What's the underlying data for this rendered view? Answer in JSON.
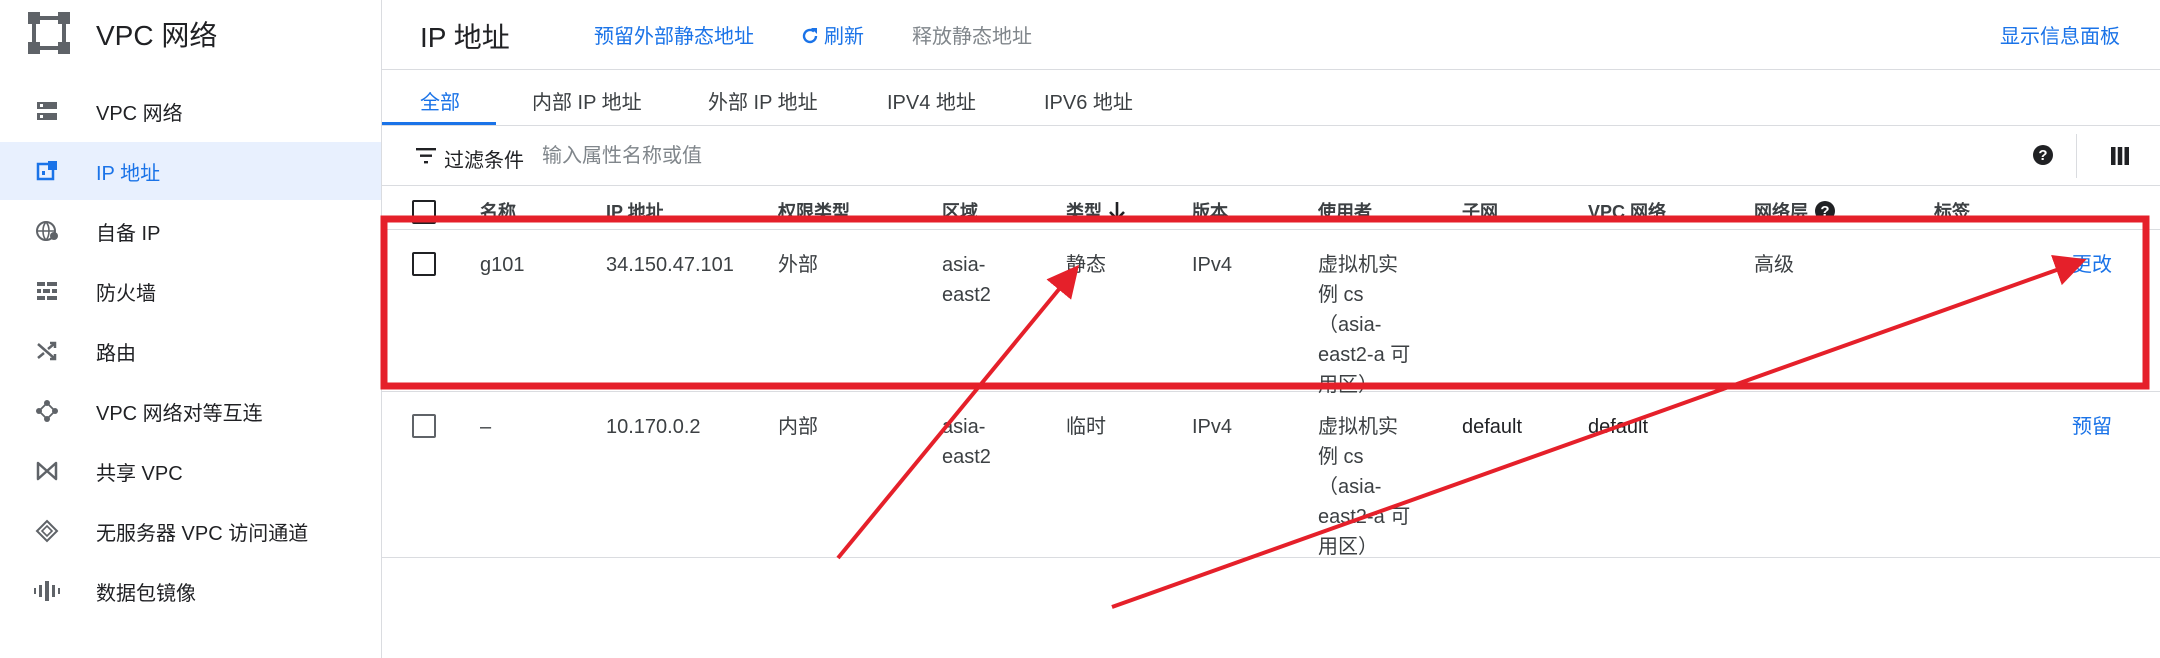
{
  "sidebar": {
    "product_title": "VPC 网络",
    "items": [
      {
        "label": "VPC 网络",
        "icon": "vpc-network-icon",
        "active": false
      },
      {
        "label": "IP 地址",
        "icon": "ip-address-icon",
        "active": true
      },
      {
        "label": "自备 IP",
        "icon": "byoip-globe-icon",
        "active": false
      },
      {
        "label": "防火墙",
        "icon": "firewall-icon",
        "active": false
      },
      {
        "label": "路由",
        "icon": "routes-icon",
        "active": false
      },
      {
        "label": "VPC 网络对等互连",
        "icon": "peering-icon",
        "active": false
      },
      {
        "label": "共享 VPC",
        "icon": "shared-vpc-icon",
        "active": false
      },
      {
        "label": "无服务器 VPC 访问通道",
        "icon": "serverless-access-icon",
        "active": false
      },
      {
        "label": "数据包镜像",
        "icon": "packet-mirroring-icon",
        "active": false
      }
    ]
  },
  "header": {
    "title": "IP 地址",
    "reserve_external_label": "预留外部静态地址",
    "refresh_label": "刷新",
    "release_label": "释放静态地址",
    "info_panel_label": "显示信息面板"
  },
  "tabs": [
    "全部",
    "内部 IP 地址",
    "外部 IP 地址",
    "IPV4 地址",
    "IPV6 地址"
  ],
  "filter": {
    "label": "过滤条件",
    "placeholder": "输入属性名称或值"
  },
  "table": {
    "columns": [
      "名称",
      "IP 地址",
      "权限类型",
      "区域",
      "类型",
      "版本",
      "使用者",
      "子网",
      "VPC 网络",
      "网络层",
      "标签"
    ],
    "rows": [
      {
        "name": "g101",
        "ip": "34.150.47.101",
        "access_type": "外部",
        "region_line1": "asia-",
        "region_line2": "east2",
        "type": "静态",
        "version": "IPv4",
        "user_lines": [
          "虚拟机实",
          "例 cs",
          "（asia-",
          "east2-a 可",
          "用区）"
        ],
        "subnet": "",
        "vpc_network": "",
        "network_tier": "高级",
        "action": "更改"
      },
      {
        "name": "–",
        "ip": "10.170.0.2",
        "access_type": "内部",
        "region_line1": "asia-",
        "region_line2": "east2",
        "type": "临时",
        "version": "IPv4",
        "user_lines": [
          "虚拟机实",
          "例 cs",
          "（asia-",
          "east2-a 可",
          "用区）"
        ],
        "subnet": "default",
        "vpc_network": "default",
        "network_tier": "",
        "action": "预留"
      }
    ]
  },
  "colors": {
    "accent": "#1a73e8",
    "annotation_red": "#e5202a",
    "active_nav_bg": "#e8f0fe"
  }
}
